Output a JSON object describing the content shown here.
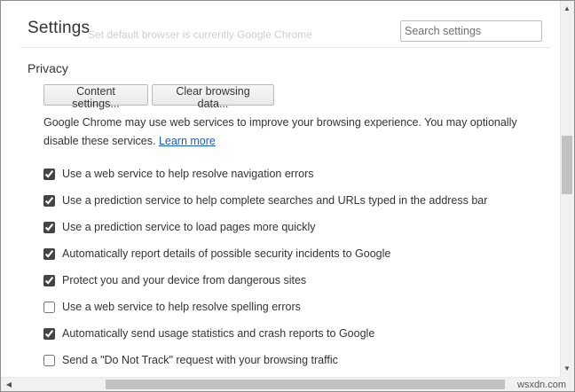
{
  "header": {
    "title": "Settings",
    "ghost_text": "Set default browser is currently Google Chrome",
    "search_placeholder": "Search settings"
  },
  "privacy": {
    "section_title": "Privacy",
    "content_settings_label": "Content settings...",
    "clear_browsing_label": "Clear browsing data...",
    "description": "Google Chrome may use web services to improve your browsing experience. You may optionally disable these services.",
    "learn_more": "Learn more",
    "options": [
      {
        "label": "Use a web service to help resolve navigation errors",
        "checked": true
      },
      {
        "label": "Use a prediction service to help complete searches and URLs typed in the address bar",
        "checked": true
      },
      {
        "label": "Use a prediction service to load pages more quickly",
        "checked": true
      },
      {
        "label": "Automatically report details of possible security incidents to Google",
        "checked": true
      },
      {
        "label": "Protect you and your device from dangerous sites",
        "checked": true
      },
      {
        "label": "Use a web service to help resolve spelling errors",
        "checked": false
      },
      {
        "label": "Automatically send usage statistics and crash reports to Google",
        "checked": true
      },
      {
        "label": "Send a \"Do Not Track\" request with your browsing traffic",
        "checked": false
      }
    ]
  },
  "scrollbar": {
    "up_arrow": "▲",
    "down_arrow": "▼",
    "left_arrow": "◀",
    "vertical_position": 0.36
  },
  "watermark": "wsxdn.com"
}
